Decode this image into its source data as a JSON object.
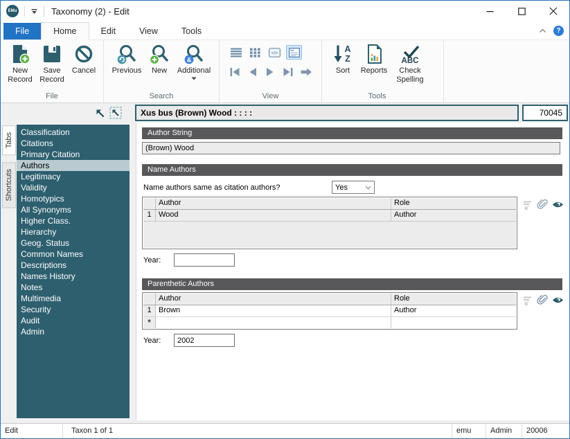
{
  "titlebar": {
    "logo": "EMu",
    "title": "Taxonomy (2) - Edit"
  },
  "ribbon": {
    "tabs": [
      "File",
      "Home",
      "Edit",
      "View",
      "Tools"
    ],
    "file_group": {
      "label": "File",
      "new_record": "New Record",
      "save_record": "Save Record",
      "cancel": "Cancel"
    },
    "search_group": {
      "label": "Search",
      "previous": "Previous",
      "new": "New",
      "additional": "Additional"
    },
    "view_group": {
      "label": "View"
    },
    "tools_group": {
      "label": "Tools",
      "sort": "Sort",
      "reports": "Reports",
      "check_spelling": "Check Spelling"
    }
  },
  "glyphs": {
    "ampersand": "&",
    "sort_a": "A",
    "sort_z": "Z",
    "abc": "ABC",
    "code": "</>",
    "help": "?",
    "new_row": "*"
  },
  "record_header": {
    "summary": "Xus bus (Brown) Wood : : : :",
    "irn": "70045"
  },
  "sidebar": {
    "vertical_tabs": [
      "Tabs",
      "Shortcuts"
    ],
    "selected": "Authors",
    "items": [
      "Classification",
      "Citations",
      "Primary Citation",
      "Authors",
      "Legitimacy",
      "Validity",
      "Homotypics",
      "All Synonyms",
      "Higher Class.",
      "Hierarchy",
      "Geog. Status",
      "Common Names",
      "Descriptions",
      "Names History",
      "Notes",
      "Multimedia",
      "Security",
      "Audit",
      "Admin"
    ]
  },
  "sections": {
    "author_string": {
      "title": "Author String",
      "value": "(Brown) Wood"
    },
    "name_authors": {
      "title": "Name Authors",
      "question": "Name authors same as citation authors?",
      "answer": "Yes",
      "columns": {
        "author": "Author",
        "role": "Role"
      },
      "rows": [
        {
          "num": "1",
          "author": "Wood",
          "role": "Author"
        }
      ],
      "year_label": "Year:",
      "year_value": ""
    },
    "parenthetic_authors": {
      "title": "Parenthetic Authors",
      "columns": {
        "author": "Author",
        "role": "Role"
      },
      "rows": [
        {
          "num": "1",
          "author": "Brown",
          "role": "Author"
        },
        {
          "num": "*",
          "author": "",
          "role": ""
        }
      ],
      "year_label": "Year:",
      "year_value": "2002"
    }
  },
  "statusbar": {
    "mode": "Edit",
    "record_position": "Taxon 1 of 1",
    "user": "emu",
    "group": "Admin",
    "port": "20006"
  },
  "colors": {
    "teal": "#2d5f6e",
    "accent_blue": "#2173c4",
    "green": "#5fb446",
    "section_header_gray": "#58585a",
    "sidebar_selected": "#b9cbd0"
  }
}
